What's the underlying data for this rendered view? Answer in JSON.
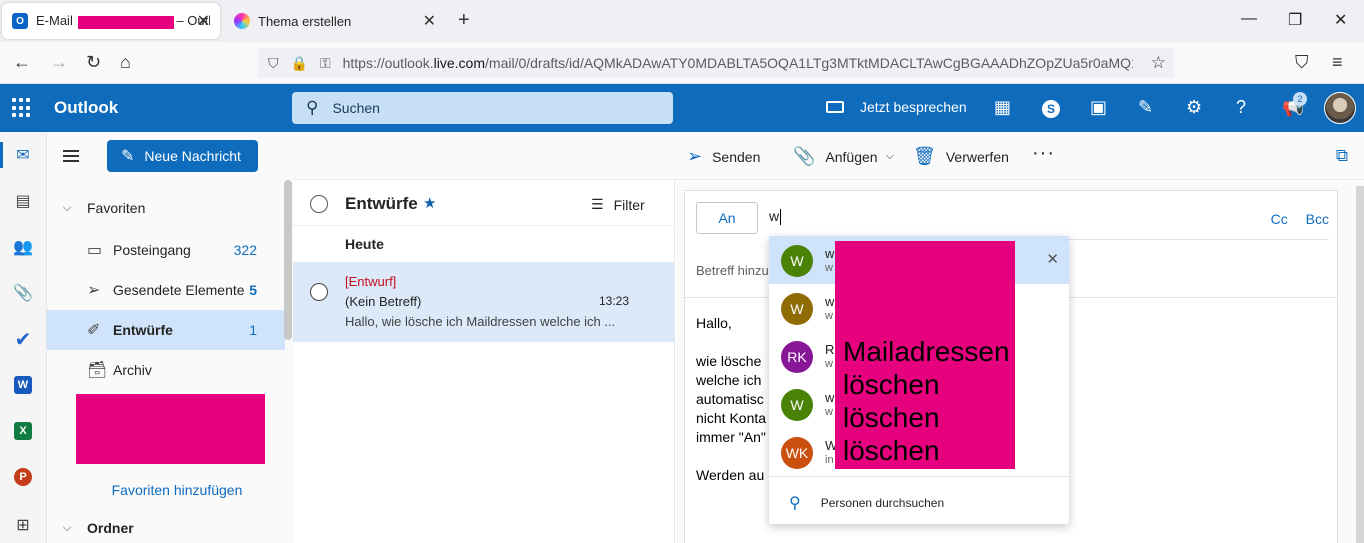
{
  "browser": {
    "tabs": [
      {
        "title_pre": "E-Mail",
        "title_post": "– Outl",
        "icon": "outlook-icon"
      },
      {
        "title": "Thema erstellen",
        "icon": "forum-icon"
      }
    ],
    "url_prefix": "https://outlook.",
    "url_domain": "live.com",
    "url_path": "/mail/0/drafts/id/AQMkADAwATY0MDABLTA5OQA1LTg3MTktMDACLTAwCgBGAAADhZOpZUa5r0aMQ1"
  },
  "outlook": {
    "brand": "Outlook",
    "search_placeholder": "Suchen",
    "meet_now": "Jetzt besprechen",
    "notification_count": "2",
    "new_message": "Neue Nachricht",
    "toolbar": {
      "send": "Senden",
      "attach": "Anfügen",
      "discard": "Verwerfen"
    },
    "folders": {
      "favorites_header": "Favoriten",
      "items": [
        {
          "label": "Posteingang",
          "count": "322"
        },
        {
          "label": "Gesendete Elemente",
          "count": "5"
        },
        {
          "label": "Entwürfe",
          "count": "1"
        },
        {
          "label": "Archiv",
          "count": ""
        }
      ],
      "add_favorites": "Favoriten hinzufügen",
      "folders_header": "Ordner"
    },
    "message_list": {
      "title": "Entwürfe",
      "filter": "Filter",
      "group": "Heute",
      "item": {
        "draft_tag": "[Entwurf]",
        "subject": "(Kein Betreff)",
        "time": "13:23",
        "preview": "Hallo, wie lösche ich Maildressen welche ich ..."
      }
    },
    "compose": {
      "to_label": "An",
      "to_value": "w",
      "cc": "Cc",
      "bcc": "Bcc",
      "subject_placeholder": "Betreff hinzu",
      "body": [
        "Hallo,",
        "",
        "wie lösche",
        "welche ich",
        "automatisc",
        "nicht Konta",
        "immer \"An\"",
        "",
        "Werden au"
      ]
    },
    "suggestions": {
      "rows": [
        {
          "initials": "W",
          "color": "#498205",
          "name": "w",
          "mail": "w"
        },
        {
          "initials": "W",
          "color": "#8f6b04",
          "name": "w",
          "mail": "w"
        },
        {
          "initials": "RK",
          "color": "#881798",
          "name": "R",
          "mail": "w"
        },
        {
          "initials": "W",
          "color": "#498205",
          "name": "w",
          "mail": "w"
        },
        {
          "initials": "WK",
          "color": "#ca5010",
          "name": "W",
          "mail": "in"
        }
      ],
      "overlay_text": [
        "Mailadressen",
        "löschen",
        "löschen",
        "löschen"
      ],
      "search_people": "Personen durchsuchen"
    }
  }
}
